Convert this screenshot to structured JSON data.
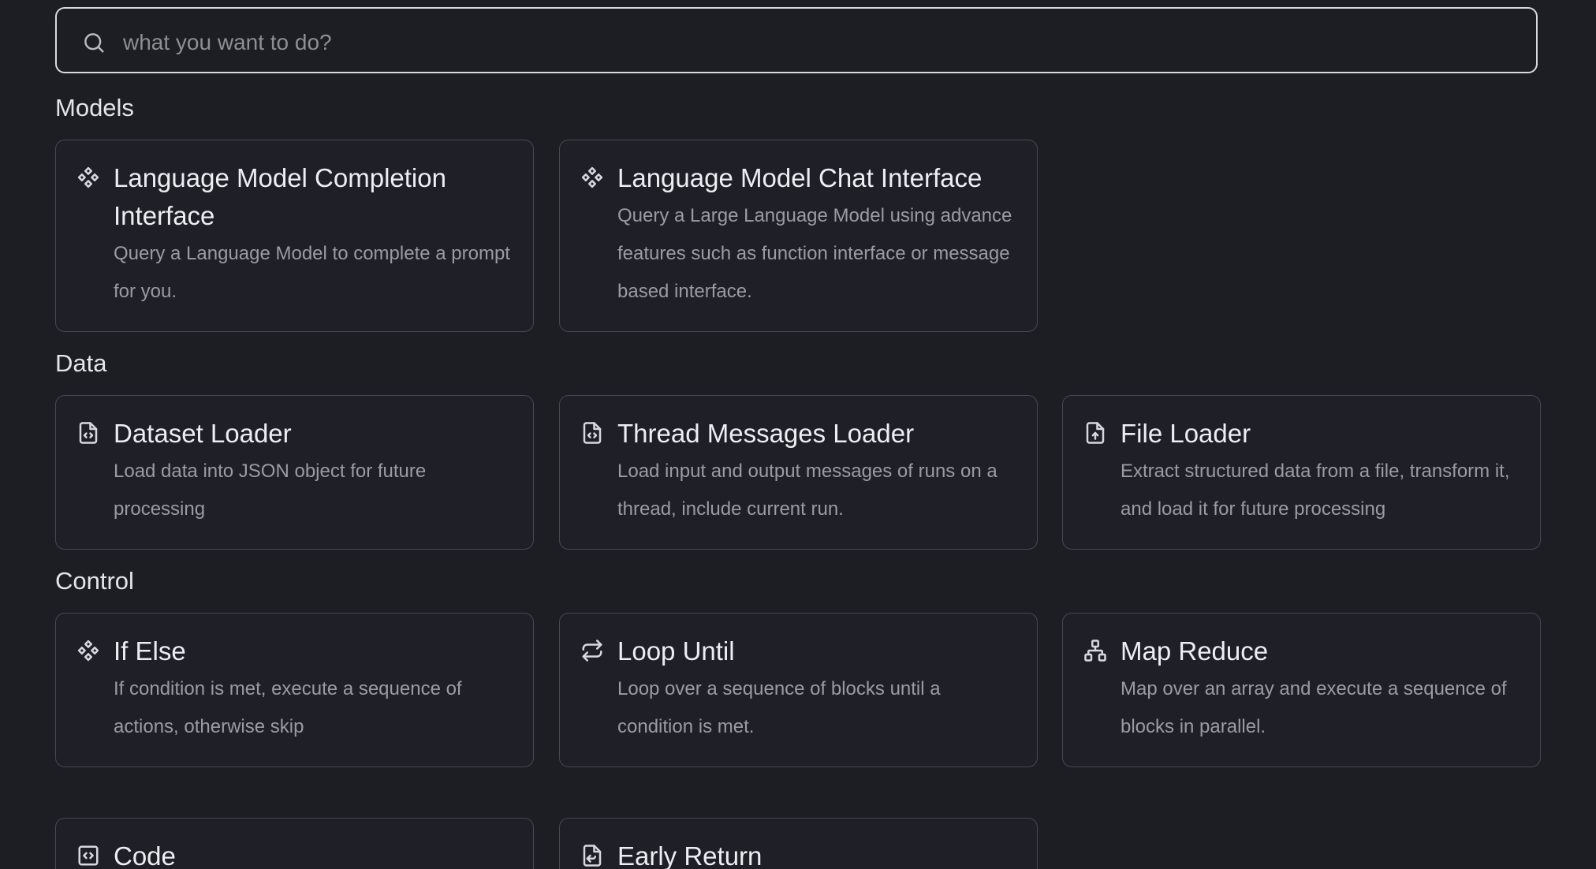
{
  "search": {
    "placeholder": "what you want to do?"
  },
  "sections": {
    "models": {
      "title": "Models",
      "cards": [
        {
          "title": "Language Model Completion Interface",
          "description": "Query a Language Model to complete a prompt for you.",
          "icon": "diamond-grid-icon"
        },
        {
          "title": "Language Model Chat Interface",
          "description": "Query a Large Language Model using advance features such as function interface or message based interface.",
          "icon": "diamond-grid-icon"
        }
      ]
    },
    "data": {
      "title": "Data",
      "cards": [
        {
          "title": "Dataset Loader",
          "description": "Load data into JSON object for future processing",
          "icon": "file-code-icon"
        },
        {
          "title": "Thread Messages Loader",
          "description": "Load input and output messages of runs on a thread, include current run.",
          "icon": "file-code-icon"
        },
        {
          "title": "File Loader",
          "description": "Extract structured data from a file, transform it, and load it for future processing",
          "icon": "file-upload-icon"
        }
      ]
    },
    "control": {
      "title": "Control",
      "cards": [
        {
          "title": "If Else",
          "description": "If condition is met, execute a sequence of actions, otherwise skip",
          "icon": "diamond-grid-icon"
        },
        {
          "title": "Loop Until",
          "description": "Loop over a sequence of blocks until a condition is met.",
          "icon": "repeat-arrows-icon"
        },
        {
          "title": "Map Reduce",
          "description": "Map over an array and execute a sequence of blocks in parallel.",
          "icon": "hierarchy-icon"
        },
        {
          "title": "Code",
          "icon": "code-square-icon"
        },
        {
          "title": "Early Return",
          "icon": "file-return-icon"
        }
      ]
    }
  },
  "colors": {
    "background": "#1d1e24",
    "card_background": "#1f2027",
    "card_border": "#464852",
    "search_border": "#d9dadf",
    "title_text": "#eceef2",
    "description_text": "#9a9ca3"
  }
}
